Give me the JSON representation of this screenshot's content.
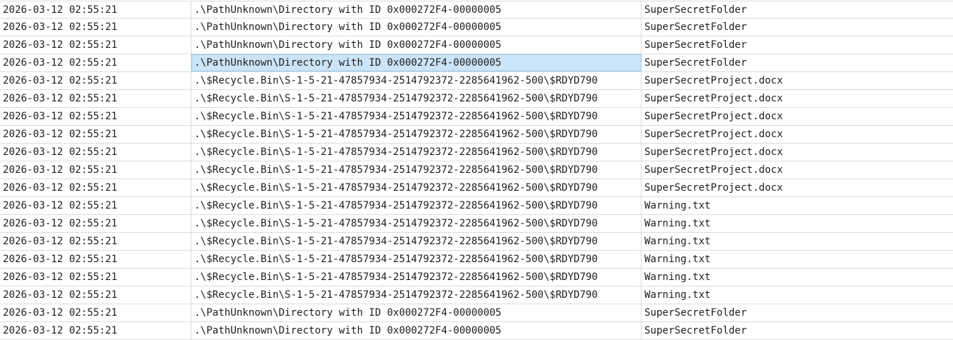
{
  "rows": [
    {
      "timestamp": "2026-03-12 02:55:21",
      "path": ".\\PathUnknown\\Directory with ID 0x000272F4-00000005",
      "name": "SuperSecretFolder"
    },
    {
      "timestamp": "2026-03-12 02:55:21",
      "path": ".\\PathUnknown\\Directory with ID 0x000272F4-00000005",
      "name": "SuperSecretFolder"
    },
    {
      "timestamp": "2026-03-12 02:55:21",
      "path": ".\\PathUnknown\\Directory with ID 0x000272F4-00000005",
      "name": "SuperSecretFolder"
    },
    {
      "timestamp": "2026-03-12 02:55:21",
      "path": ".\\PathUnknown\\Directory with ID 0x000272F4-00000005",
      "name": "SuperSecretFolder"
    },
    {
      "timestamp": "2026-03-12 02:55:21",
      "path": ".\\$Recycle.Bin\\S-1-5-21-47857934-2514792372-2285641962-500\\$RDYD790",
      "name": "SuperSecretProject.docx"
    },
    {
      "timestamp": "2026-03-12 02:55:21",
      "path": ".\\$Recycle.Bin\\S-1-5-21-47857934-2514792372-2285641962-500\\$RDYD790",
      "name": "SuperSecretProject.docx"
    },
    {
      "timestamp": "2026-03-12 02:55:21",
      "path": ".\\$Recycle.Bin\\S-1-5-21-47857934-2514792372-2285641962-500\\$RDYD790",
      "name": "SuperSecretProject.docx"
    },
    {
      "timestamp": "2026-03-12 02:55:21",
      "path": ".\\$Recycle.Bin\\S-1-5-21-47857934-2514792372-2285641962-500\\$RDYD790",
      "name": "SuperSecretProject.docx"
    },
    {
      "timestamp": "2026-03-12 02:55:21",
      "path": ".\\$Recycle.Bin\\S-1-5-21-47857934-2514792372-2285641962-500\\$RDYD790",
      "name": "SuperSecretProject.docx"
    },
    {
      "timestamp": "2026-03-12 02:55:21",
      "path": ".\\$Recycle.Bin\\S-1-5-21-47857934-2514792372-2285641962-500\\$RDYD790",
      "name": "SuperSecretProject.docx"
    },
    {
      "timestamp": "2026-03-12 02:55:21",
      "path": ".\\$Recycle.Bin\\S-1-5-21-47857934-2514792372-2285641962-500\\$RDYD790",
      "name": "SuperSecretProject.docx"
    },
    {
      "timestamp": "2026-03-12 02:55:21",
      "path": ".\\$Recycle.Bin\\S-1-5-21-47857934-2514792372-2285641962-500\\$RDYD790",
      "name": "Warning.txt"
    },
    {
      "timestamp": "2026-03-12 02:55:21",
      "path": ".\\$Recycle.Bin\\S-1-5-21-47857934-2514792372-2285641962-500\\$RDYD790",
      "name": "Warning.txt"
    },
    {
      "timestamp": "2026-03-12 02:55:21",
      "path": ".\\$Recycle.Bin\\S-1-5-21-47857934-2514792372-2285641962-500\\$RDYD790",
      "name": "Warning.txt"
    },
    {
      "timestamp": "2026-03-12 02:55:21",
      "path": ".\\$Recycle.Bin\\S-1-5-21-47857934-2514792372-2285641962-500\\$RDYD790",
      "name": "Warning.txt"
    },
    {
      "timestamp": "2026-03-12 02:55:21",
      "path": ".\\$Recycle.Bin\\S-1-5-21-47857934-2514792372-2285641962-500\\$RDYD790",
      "name": "Warning.txt"
    },
    {
      "timestamp": "2026-03-12 02:55:21",
      "path": ".\\$Recycle.Bin\\S-1-5-21-47857934-2514792372-2285641962-500\\$RDYD790",
      "name": "Warning.txt"
    },
    {
      "timestamp": "2026-03-12 02:55:21",
      "path": ".\\PathUnknown\\Directory with ID 0x000272F4-00000005",
      "name": "SuperSecretFolder"
    },
    {
      "timestamp": "2026-03-12 02:55:21",
      "path": ".\\PathUnknown\\Directory with ID 0x000272F4-00000005",
      "name": "SuperSecretFolder"
    }
  ],
  "selection": {
    "row": 3,
    "column": "path"
  },
  "colors": {
    "gridline": "#dcdcdc",
    "selection_fill": "#cce4f7",
    "selection_border": "#99c9ef",
    "text": "#1e1e1e"
  }
}
